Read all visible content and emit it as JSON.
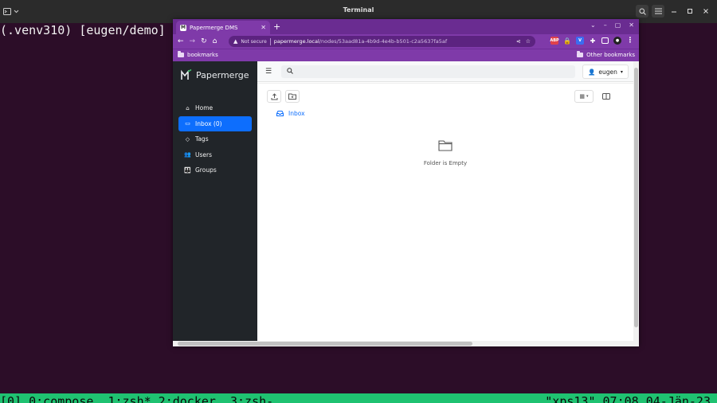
{
  "terminal": {
    "title": "Terminal",
    "prompt": "(.venv310) [eugen/demo] $",
    "status_left": "[0] 0:compose  1:zsh* 2:docker  3:zsh-",
    "status_right": "\"xps13\" 07:08 04-Jän-23",
    "icons": [
      "terminal-new-tab-icon",
      "search-icon",
      "hamburger-menu-icon",
      "minimize-icon",
      "maximize-icon",
      "close-icon"
    ]
  },
  "browser": {
    "tab_title": "Papermerge DMS",
    "new_tab": "+",
    "url_warning": "Not secure",
    "url_host": "papermerge.local",
    "url_path": "/nodes/53aad81a-4b9d-4e4b-b501-c2a5637fa5af",
    "bookmark_left": "bookmarks",
    "bookmark_right": "Other bookmarks",
    "accent": "#7f3aa9"
  },
  "app": {
    "brand": "Papermerge",
    "menu": [
      {
        "label": "Home",
        "icon": "home-icon"
      },
      {
        "label": "Inbox (0)",
        "icon": "inbox-icon",
        "active": true
      },
      {
        "label": "Tags",
        "icon": "tag-icon"
      },
      {
        "label": "Users",
        "icon": "users-icon"
      },
      {
        "label": "Groups",
        "icon": "groups-icon"
      }
    ],
    "user": "eugen",
    "breadcrumb": "Inbox",
    "empty_message": "Folder is Empty",
    "primary_color": "#0d6efd"
  }
}
